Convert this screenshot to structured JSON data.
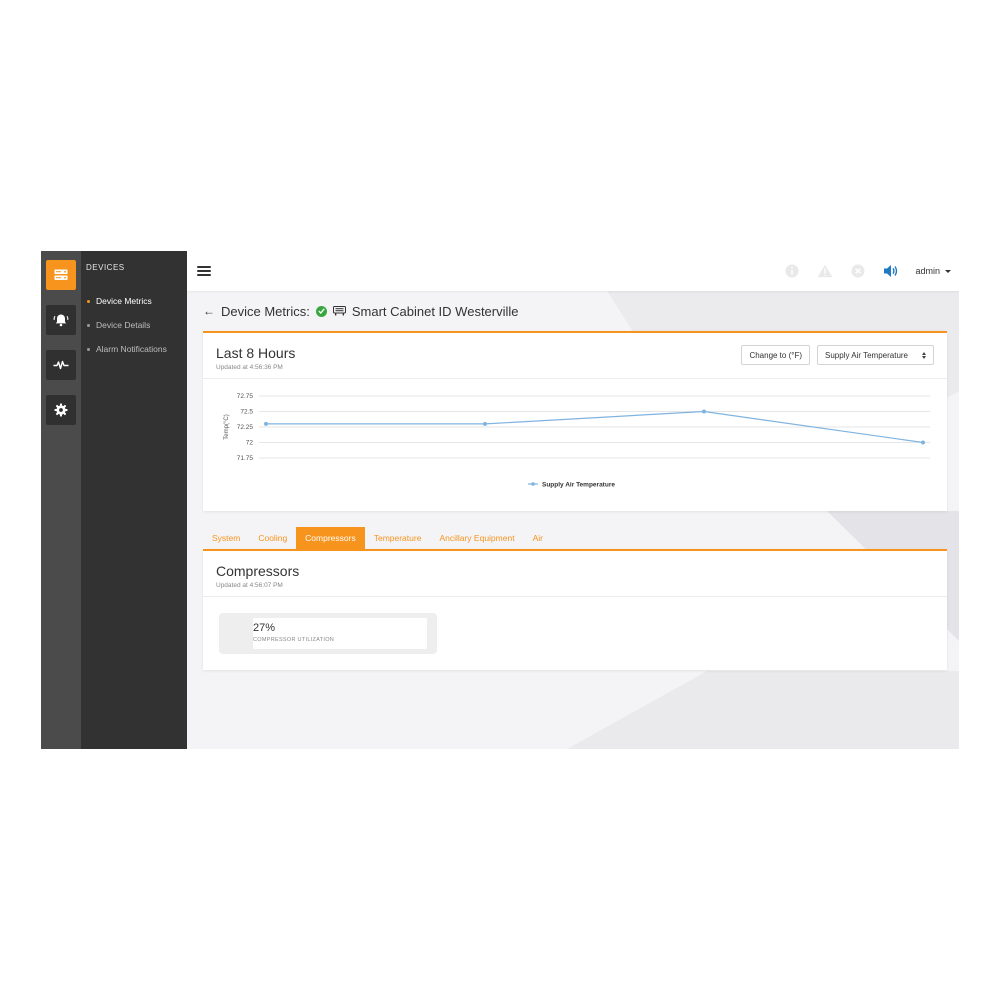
{
  "colors": {
    "accent": "#f7941d",
    "sidebar_rail": "#4b4b4b",
    "sidebar_panel": "#323232",
    "status_ok": "#3aa63f",
    "chart_line": "#7fb3e0",
    "speaker": "#1f7ac2"
  },
  "rail": {
    "items": [
      {
        "icon": "server-icon",
        "active": true
      },
      {
        "icon": "alarm-bell-icon",
        "active": false
      },
      {
        "icon": "pulse-icon",
        "active": false
      },
      {
        "icon": "gear-icon",
        "active": false
      }
    ]
  },
  "subnav": {
    "title": "DEVICES",
    "items": [
      {
        "label": "Device Metrics",
        "active": true
      },
      {
        "label": "Device Details",
        "active": false
      },
      {
        "label": "Alarm Notifications",
        "active": false
      }
    ]
  },
  "topbar": {
    "icons": [
      "info-icon",
      "warning-icon",
      "close-circle-icon",
      "speaker-icon"
    ],
    "user": "admin"
  },
  "page": {
    "title": "Device Metrics:",
    "device_name": "Smart Cabinet ID Westerville"
  },
  "chart_card": {
    "title": "Last 8 Hours",
    "updated": "Updated at 4:56:36 PM",
    "unit_button": "Change to (°F)",
    "metric_select": "Supply Air Temperature"
  },
  "chart_data": {
    "type": "line",
    "series": [
      {
        "name": "Supply Air Temperature",
        "values": [
          72.3,
          72.3,
          72.5,
          72.0
        ]
      }
    ],
    "ylabel": "Temp(°C)",
    "ylim": [
      71.75,
      72.75
    ],
    "yticks": [
      "72.75",
      "72.5",
      "72.25",
      "72",
      "71.75"
    ],
    "grid": true,
    "legend": "bottom"
  },
  "tabs": [
    {
      "label": "System",
      "active": false
    },
    {
      "label": "Cooling",
      "active": false
    },
    {
      "label": "Compressors",
      "active": true
    },
    {
      "label": "Temperature",
      "active": false
    },
    {
      "label": "Ancillary Equipment",
      "active": false
    },
    {
      "label": "Air",
      "active": false
    }
  ],
  "compressors": {
    "title": "Compressors",
    "updated": "Updated at 4:56:07 PM",
    "metric": {
      "value": "27%",
      "label": "COMPRESSOR UTILIZATION"
    }
  }
}
